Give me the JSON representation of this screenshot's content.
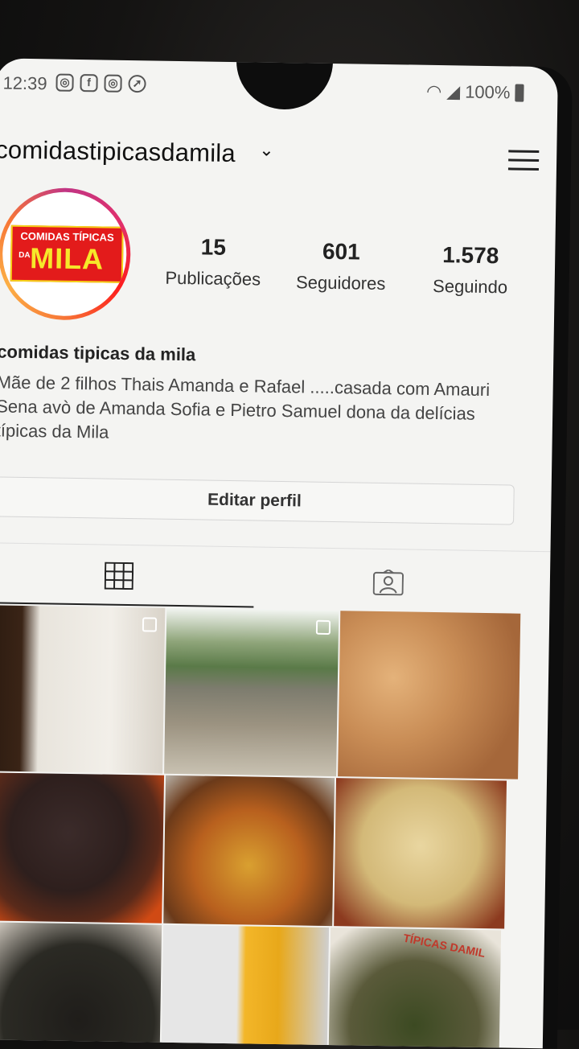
{
  "status_bar": {
    "time": "12:39",
    "battery": "100%",
    "notification_icons": [
      "instagram-icon",
      "facebook-icon",
      "instagram-icon",
      "direct-icon"
    ]
  },
  "header": {
    "username": "comidastipicasdamila"
  },
  "profile": {
    "avatar_logo": {
      "top": "COMIDAS TÍPICAS",
      "small": "DA",
      "main": "MILA"
    },
    "stats": [
      {
        "value": "15",
        "label": "Publicações"
      },
      {
        "value": "601",
        "label": "Seguidores"
      },
      {
        "value": "1.578",
        "label": "Seguindo"
      }
    ],
    "name": "comidas tipicas da mila",
    "bio": "Mãe de 2 filhos Thais Amanda  e Rafael  .....casada com Amauri Sena avò  de Amanda Sofia  e Pietro Samuel  dona da delícias típicas da Mila",
    "edit_button": "Editar perfil"
  },
  "tabs": [
    "grid-icon",
    "tagged-icon"
  ],
  "grid": {
    "tile_9_text": "TÍPICAS DAMIL"
  },
  "colors": {
    "background": "#f4f4f2",
    "logo_red": "#e31b1b",
    "logo_yellow": "#f6e82a"
  }
}
